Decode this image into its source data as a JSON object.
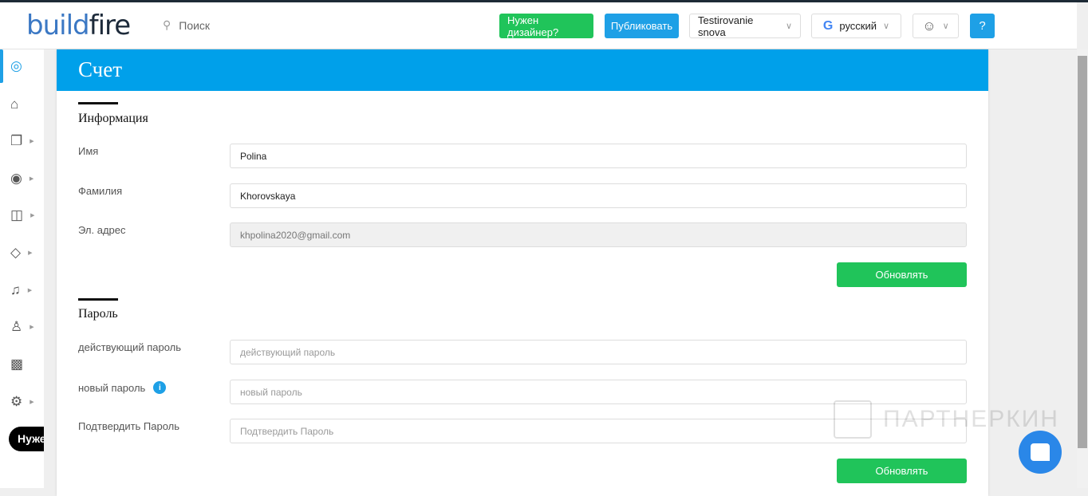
{
  "header": {
    "logo": {
      "part1": "build",
      "part2": "fire"
    },
    "search_placeholder": "Поиск",
    "need_designer": "Нужен дизайнер?",
    "publish": "Публиковать",
    "app_select": "Testirovanie snova",
    "language": "русский"
  },
  "sidebar": {
    "items": [
      "support",
      "home",
      "pages",
      "design",
      "security",
      "tags",
      "notifications",
      "users",
      "analytics",
      "settings"
    ],
    "pill": "Нужен"
  },
  "page": {
    "title": "Счет",
    "info": {
      "title": "Информация",
      "first_name_label": "Имя",
      "first_name": "Polina",
      "last_name_label": "Фамилия",
      "last_name": "Khorovskaya",
      "email_label": "Эл. адрес",
      "email": "khpolina2020@gmail.com",
      "update": "Обновлять"
    },
    "password": {
      "title": "Пароль",
      "current_label": "действующий пароль",
      "current_placeholder": "действующий пароль",
      "new_label": "новый пароль",
      "new_placeholder": "новый пароль",
      "confirm_label": "Подтвердить Пароль",
      "confirm_placeholder": "Подтвердить Пароль",
      "update": "Обновлять"
    }
  },
  "watermark": "ПАРТНЕРКИН",
  "colors": {
    "accent": "#00a0ea",
    "green": "#20c45a"
  }
}
